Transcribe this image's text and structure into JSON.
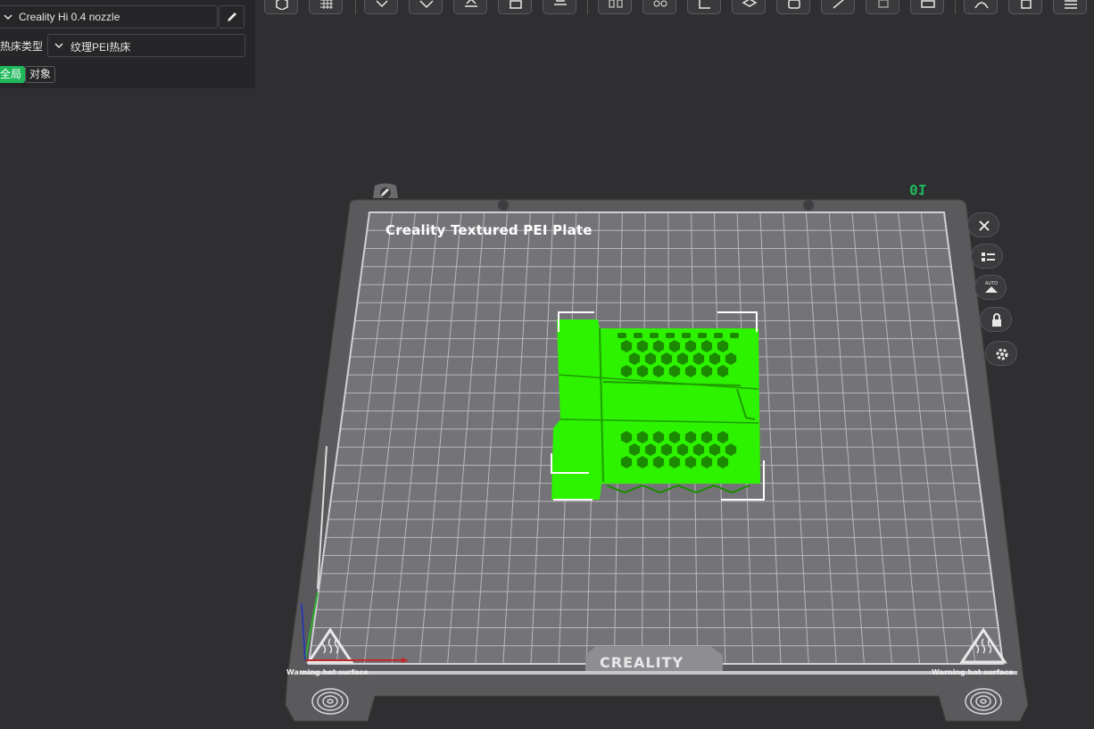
{
  "printer": {
    "name": "Creality Hi 0.4 nozzle"
  },
  "bed": {
    "label": "热床类型",
    "value": "纹理PEI热床"
  },
  "scope_tabs": {
    "global": "全局",
    "object": "对象"
  },
  "plate": {
    "title": "Creality Textured PEI Plate",
    "brand": "CREALITY",
    "warning_left": "Warning hot surface",
    "warning_right": "Warning hot surface",
    "number": "01"
  },
  "side_buttons": [
    "close-icon",
    "list-icon",
    "auto-arrange-icon",
    "lock-icon",
    "gear-icon"
  ],
  "toolbar_icons": [
    "cube-icon",
    "grid-icon",
    "download-icon",
    "diamond-icon",
    "layer-paint-icon",
    "split-icon",
    "slice-icon",
    "brackets-icon",
    "support-icon",
    "dimension-icon",
    "layers-icon",
    "camera-icon",
    "cut-icon",
    "square-icon",
    "frame-icon",
    "arch-icon",
    "export-icon",
    "menu-icon"
  ],
  "colors": {
    "accent": "#1fb85b",
    "model": "#2df200",
    "background": "#2f2f31",
    "plate": "#5c5c5f"
  }
}
